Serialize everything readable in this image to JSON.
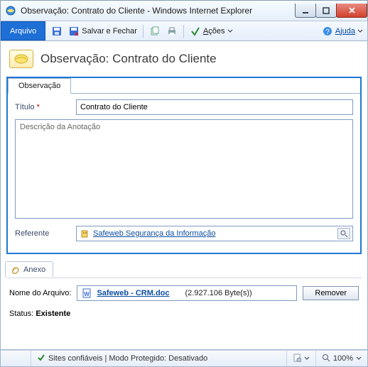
{
  "window": {
    "title": "Observação: Contrato do Cliente - Windows Internet Explorer"
  },
  "toolbar": {
    "arquivo": "Arquivo",
    "salvar_fechar": "Salvar e Fechar",
    "acoes_prefix": "A",
    "acoes_rest": "ções",
    "ajuda_prefix": "A",
    "ajuda_rest": "juda"
  },
  "header": {
    "title": "Observação: Contrato do Cliente"
  },
  "tab": {
    "observacao": "Observação"
  },
  "form": {
    "titulo_label": "Título",
    "titulo_value": "Contrato do Cliente",
    "descricao_placeholder": "Descrição da Anotação",
    "referente_label": "Referente",
    "referente_value": "Safeweb Segurança da Informação"
  },
  "anexo": {
    "tab": "Anexo",
    "nome_label": "Nome do Arquivo:",
    "filename": "Safeweb - CRM.doc",
    "filesize": "(2.927.106 Byte(s))",
    "remover": "Remover"
  },
  "status": {
    "label": "Status:",
    "value": "Existente"
  },
  "statusbar": {
    "zone": "Sites confiáveis | Modo Protegido: Desativado",
    "zoom": "100%"
  }
}
